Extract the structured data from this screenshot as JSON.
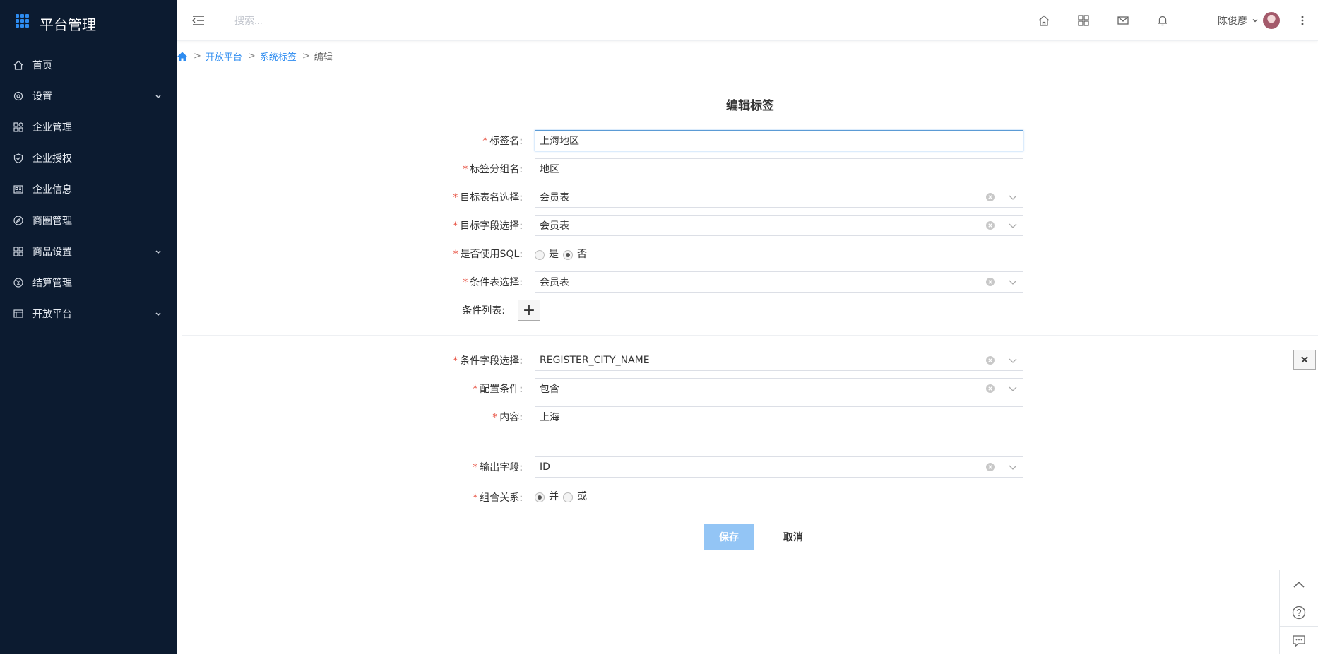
{
  "sidebar": {
    "title": "平台管理",
    "items": [
      {
        "label": "首页",
        "icon": "home-icon"
      },
      {
        "label": "设置",
        "icon": "settings-icon",
        "expandable": true
      },
      {
        "label": "企业管理",
        "icon": "org-icon"
      },
      {
        "label": "企业授权",
        "icon": "shield-icon"
      },
      {
        "label": "企业信息",
        "icon": "card-icon"
      },
      {
        "label": "商圈管理",
        "icon": "compass-icon"
      },
      {
        "label": "商品设置",
        "icon": "grid-icon",
        "expandable": true
      },
      {
        "label": "结算管理",
        "icon": "yen-icon"
      },
      {
        "label": "开放平台",
        "icon": "table-icon",
        "expandable": true
      }
    ]
  },
  "header": {
    "search_placeholder": "搜索...",
    "user_name": "陈俊彦"
  },
  "breadcrumb": {
    "items": [
      "开放平台",
      "系统标签",
      "编辑"
    ]
  },
  "form": {
    "title": "编辑标签",
    "tag_name_label": "标签名:",
    "tag_name_value": "上海地区",
    "tag_group_label": "标签分组名:",
    "tag_group_value": "地区",
    "target_table_label": "目标表名选择:",
    "target_table_value": "会员表",
    "target_field_label": "目标字段选择:",
    "target_field_value": "会员表",
    "use_sql_label": "是否使用SQL:",
    "use_sql_options": [
      "是",
      "否"
    ],
    "use_sql_selected": "否",
    "cond_table_label": "条件表选择:",
    "cond_table_value": "会员表",
    "cond_list_label": "条件列表:",
    "cond_field_label": "条件字段选择:",
    "cond_field_value": "REGISTER_CITY_NAME",
    "config_cond_label": "配置条件:",
    "config_cond_value": "包含",
    "content_label": "内容:",
    "content_value": "上海",
    "output_field_label": "输出字段:",
    "output_field_value": "ID",
    "combine_label": "组合关系:",
    "combine_options": [
      "并",
      "或"
    ],
    "combine_selected": "并",
    "save_label": "保存",
    "cancel_label": "取消"
  },
  "colors": {
    "sidebar_bg": "#0c1b30",
    "accent": "#2e8cf0",
    "required": "#e74c3c",
    "save_button": "#93c5f5"
  }
}
